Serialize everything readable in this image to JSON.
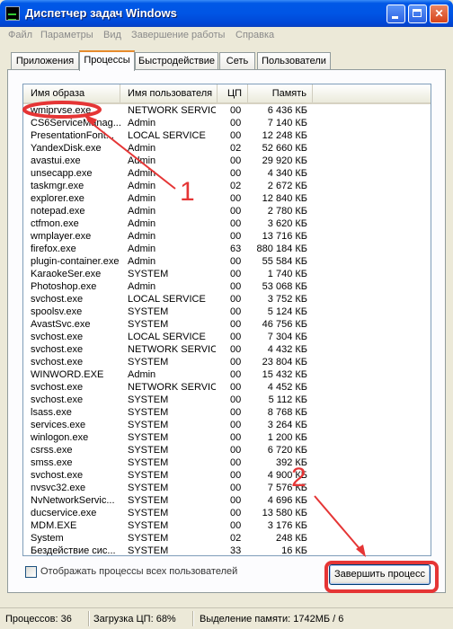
{
  "window": {
    "title": "Диспетчер задач Windows"
  },
  "menu": [
    "Файл",
    "Параметры",
    "Вид",
    "Завершение работы",
    "Справка"
  ],
  "tabs": [
    {
      "label": "Приложения",
      "active": false
    },
    {
      "label": "Процессы",
      "active": true
    },
    {
      "label": "Быстродействие",
      "active": false
    },
    {
      "label": "Сеть",
      "active": false
    },
    {
      "label": "Пользователи",
      "active": false
    }
  ],
  "table": {
    "headers": {
      "name": "Имя образа",
      "user": "Имя пользователя",
      "cpu": "ЦП",
      "mem": "Память"
    },
    "rows": [
      {
        "name": "wmiprvse.exe",
        "user": "NETWORK SERVICE",
        "cpu": "00",
        "mem": "6 436 КБ"
      },
      {
        "name": "CS6ServiceManag...",
        "user": "Admin",
        "cpu": "00",
        "mem": "7 140 КБ"
      },
      {
        "name": "PresentationFont...",
        "user": "LOCAL SERVICE",
        "cpu": "00",
        "mem": "12 248 КБ"
      },
      {
        "name": "YandexDisk.exe",
        "user": "Admin",
        "cpu": "02",
        "mem": "52 660 КБ"
      },
      {
        "name": "avastui.exe",
        "user": "Admin",
        "cpu": "00",
        "mem": "29 920 КБ"
      },
      {
        "name": "unsecapp.exe",
        "user": "Admin",
        "cpu": "00",
        "mem": "4 340 КБ"
      },
      {
        "name": "taskmgr.exe",
        "user": "Admin",
        "cpu": "02",
        "mem": "2 672 КБ"
      },
      {
        "name": "explorer.exe",
        "user": "Admin",
        "cpu": "00",
        "mem": "12 840 КБ"
      },
      {
        "name": "notepad.exe",
        "user": "Admin",
        "cpu": "00",
        "mem": "2 780 КБ"
      },
      {
        "name": "ctfmon.exe",
        "user": "Admin",
        "cpu": "00",
        "mem": "3 620 КБ"
      },
      {
        "name": "wmplayer.exe",
        "user": "Admin",
        "cpu": "00",
        "mem": "13 716 КБ"
      },
      {
        "name": "firefox.exe",
        "user": "Admin",
        "cpu": "63",
        "mem": "880 184 КБ"
      },
      {
        "name": "plugin-container.exe",
        "user": "Admin",
        "cpu": "00",
        "mem": "55 584 КБ"
      },
      {
        "name": "KaraokeSer.exe",
        "user": "SYSTEM",
        "cpu": "00",
        "mem": "1 740 КБ"
      },
      {
        "name": "Photoshop.exe",
        "user": "Admin",
        "cpu": "00",
        "mem": "53 068 КБ"
      },
      {
        "name": "svchost.exe",
        "user": "LOCAL SERVICE",
        "cpu": "00",
        "mem": "3 752 КБ"
      },
      {
        "name": "spoolsv.exe",
        "user": "SYSTEM",
        "cpu": "00",
        "mem": "5 124 КБ"
      },
      {
        "name": "AvastSvc.exe",
        "user": "SYSTEM",
        "cpu": "00",
        "mem": "46 756 КБ"
      },
      {
        "name": "svchost.exe",
        "user": "LOCAL SERVICE",
        "cpu": "00",
        "mem": "7 304 КБ"
      },
      {
        "name": "svchost.exe",
        "user": "NETWORK SERVICE",
        "cpu": "00",
        "mem": "4 432 КБ"
      },
      {
        "name": "svchost.exe",
        "user": "SYSTEM",
        "cpu": "00",
        "mem": "23 804 КБ"
      },
      {
        "name": "WINWORD.EXE",
        "user": "Admin",
        "cpu": "00",
        "mem": "15 432 КБ"
      },
      {
        "name": "svchost.exe",
        "user": "NETWORK SERVICE",
        "cpu": "00",
        "mem": "4 452 КБ"
      },
      {
        "name": "svchost.exe",
        "user": "SYSTEM",
        "cpu": "00",
        "mem": "5 112 КБ"
      },
      {
        "name": "lsass.exe",
        "user": "SYSTEM",
        "cpu": "00",
        "mem": "8 768 КБ"
      },
      {
        "name": "services.exe",
        "user": "SYSTEM",
        "cpu": "00",
        "mem": "3 264 КБ"
      },
      {
        "name": "winlogon.exe",
        "user": "SYSTEM",
        "cpu": "00",
        "mem": "1 200 КБ"
      },
      {
        "name": "csrss.exe",
        "user": "SYSTEM",
        "cpu": "00",
        "mem": "6 720 КБ"
      },
      {
        "name": "smss.exe",
        "user": "SYSTEM",
        "cpu": "00",
        "mem": "392 КБ"
      },
      {
        "name": "svchost.exe",
        "user": "SYSTEM",
        "cpu": "00",
        "mem": "4 900 КБ"
      },
      {
        "name": "nvsvc32.exe",
        "user": "SYSTEM",
        "cpu": "00",
        "mem": "7 576 КБ"
      },
      {
        "name": "NvNetworkServic...",
        "user": "SYSTEM",
        "cpu": "00",
        "mem": "4 696 КБ"
      },
      {
        "name": "ducservice.exe",
        "user": "SYSTEM",
        "cpu": "00",
        "mem": "13 580 КБ"
      },
      {
        "name": "MDM.EXE",
        "user": "SYSTEM",
        "cpu": "00",
        "mem": "3 176 КБ"
      },
      {
        "name": "System",
        "user": "SYSTEM",
        "cpu": "02",
        "mem": "248 КБ"
      },
      {
        "name": "Бездействие сис...",
        "user": "SYSTEM",
        "cpu": "33",
        "mem": "16 КБ"
      }
    ]
  },
  "show_all_checkbox": {
    "label": "Отображать процессы всех пользователей",
    "checked": false
  },
  "end_process_button": "Завершить процесс",
  "status": {
    "processes": "Процессов: 36",
    "cpu_load": "Загрузка ЦП: 68%",
    "commit": "Выделение памяти: 1742МБ / 6"
  },
  "annotations": {
    "label_1": "1",
    "label_2": "2",
    "color": "#e53535"
  }
}
